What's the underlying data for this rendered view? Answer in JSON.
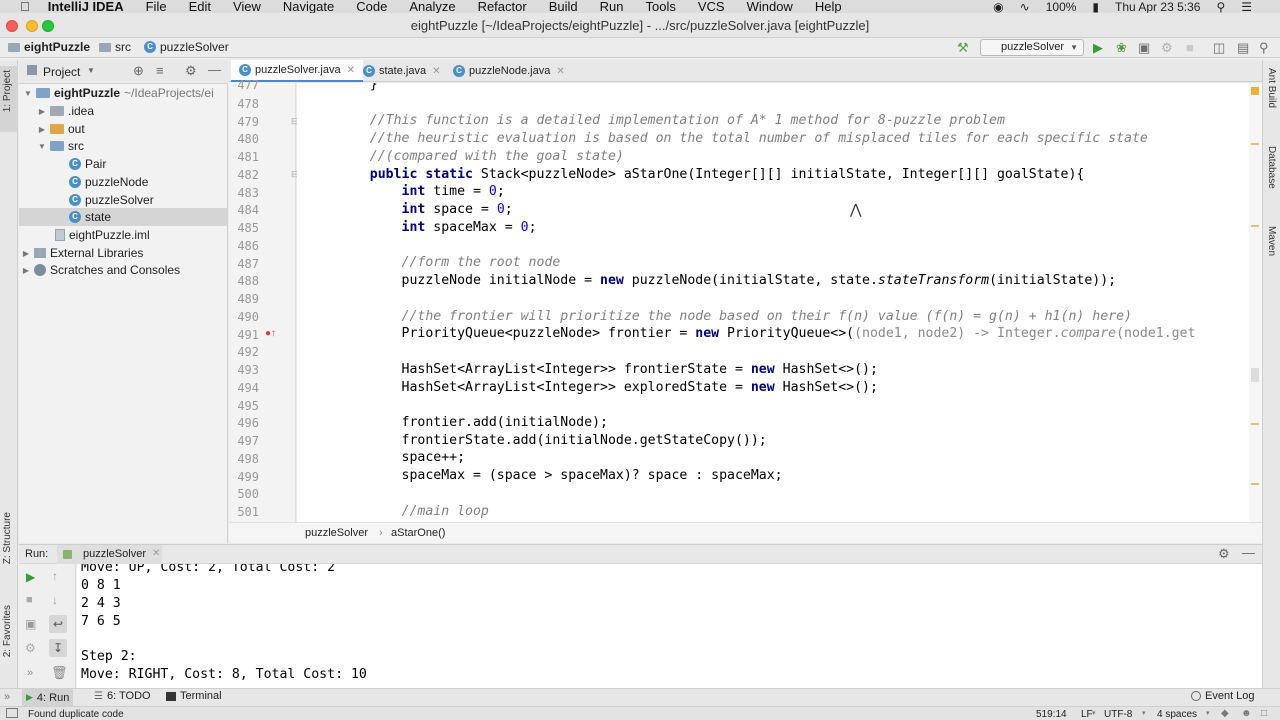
{
  "menubar": {
    "app_name": "IntelliJ IDEA",
    "items": [
      "File",
      "Edit",
      "View",
      "Navigate",
      "Code",
      "Analyze",
      "Refactor",
      "Build",
      "Run",
      "Tools",
      "VCS",
      "Window",
      "Help"
    ],
    "battery": "100%",
    "clock": "Thu Apr 23  5:36"
  },
  "window": {
    "title": "eightPuzzle [~/IdeaProjects/eightPuzzle] - .../src/puzzleSolver.java [eightPuzzle]"
  },
  "navbar": {
    "crumbs": [
      "eightPuzzle",
      "src",
      "puzzleSolver"
    ],
    "run_config": "puzzleSolver"
  },
  "left_stripe": {
    "project_tab": "1: Project",
    "structure_tab": "Z: Structure",
    "favorites_tab": "2: Favorites"
  },
  "right_stripe": {
    "tabs": [
      "Ant Build",
      "Database",
      "Maven"
    ]
  },
  "project": {
    "header": "Project",
    "root": {
      "name": "eightPuzzle",
      "path": "~/IdeaProjects/ei"
    },
    "items": {
      "idea": ".idea",
      "out": "out",
      "src": "src",
      "pair": "Pair",
      "puzzle_node": "puzzleNode",
      "puzzle_solver": "puzzleSolver",
      "state": "state",
      "iml": "eightPuzzle.iml",
      "external": "External Libraries",
      "scratches": "Scratches and Consoles"
    }
  },
  "editor": {
    "tabs": [
      "puzzleSolver.java",
      "state.java",
      "puzzleNode.java"
    ],
    "line_numbers": [
      "477",
      "478",
      "479",
      "480",
      "481",
      "482",
      "483",
      "484",
      "485",
      "486",
      "487",
      "488",
      "489",
      "490",
      "491",
      "492",
      "493",
      "494",
      "495",
      "496",
      "497",
      "498",
      "499",
      "500",
      "501"
    ],
    "code": {
      "l477": "    }",
      "l479": "    //This function is a detailed implementation of A* 1 method for 8-puzzle problem",
      "l480": "    //the heuristic evaluation is based on the total number of misplaced tiles for each specific state",
      "l481": "    //(compared with the goal state)",
      "l482_kw": "    public static",
      "l482_rest": " Stack<puzzleNode> aStarOne(Integer[][] initialState, Integer[][] goalState){",
      "l483_kw": "        int",
      "l483_mid": " time = ",
      "l483_num": "0",
      "l483_end": ";",
      "l484_kw": "        int",
      "l484_mid": " space = ",
      "l484_num": "0",
      "l484_end": ";",
      "l485_kw": "        int",
      "l485_mid": " spaceMax = ",
      "l485_num": "0",
      "l485_end": ";",
      "l487": "        //form the root node",
      "l488_a": "        puzzleNode initialNode = ",
      "l488_kw": "new",
      "l488_b": " puzzleNode(initialState, state.",
      "l488_it": "stateTransform",
      "l488_c": "(initialState));",
      "l490": "        //the frontier will prioritize the node based on their f(n) value (f(n) = g(n) + h1(n) here)",
      "l491_a": "        PriorityQueue<puzzleNode> frontier = ",
      "l491_kw": "new",
      "l491_b": " PriorityQueue<>(",
      "l491_gray": "(node1, node2) -> Integer.",
      "l491_it": "compare",
      "l491_c": "(node1.get",
      "l493_a": "        HashSet<ArrayList<Integer>> frontierState = ",
      "l493_kw": "new",
      "l493_b": " HashSet<>();",
      "l494_a": "        HashSet<ArrayList<Integer>> exploredState = ",
      "l494_kw": "new",
      "l494_b": " HashSet<>();",
      "l496": "        frontier.add(initialNode);",
      "l497": "        frontierState.add(initialNode.getStateCopy());",
      "l498": "        space++;",
      "l499": "        spaceMax = (space > spaceMax)? space : spaceMax;",
      "l501": "        //main loop"
    },
    "breadcrumb": [
      "puzzleSolver",
      "aStarOne()"
    ]
  },
  "run": {
    "label": "Run:",
    "tab": "puzzleSolver",
    "console": [
      "Move: UP, Cost: 2, Total Cost: 2",
      "0 8 1",
      "2 4 3",
      "7 6 5",
      "",
      "Step 2:",
      "Move: RIGHT, Cost: 8, Total Cost: 10"
    ]
  },
  "tool_tabs": {
    "run": "4: Run",
    "todo": "6: TODO",
    "terminal": "Terminal",
    "event_log": "Event Log"
  },
  "status": {
    "message": "Found duplicate code",
    "position": "519:14",
    "line_sep": "LF",
    "encoding": "UTF-8",
    "indent": "4 spaces"
  },
  "colors": {
    "keyword": "#000080",
    "comment": "#808080",
    "number": "#0000ff",
    "selection": "#d5d5d5",
    "tab_underline": "#4a88c7"
  }
}
